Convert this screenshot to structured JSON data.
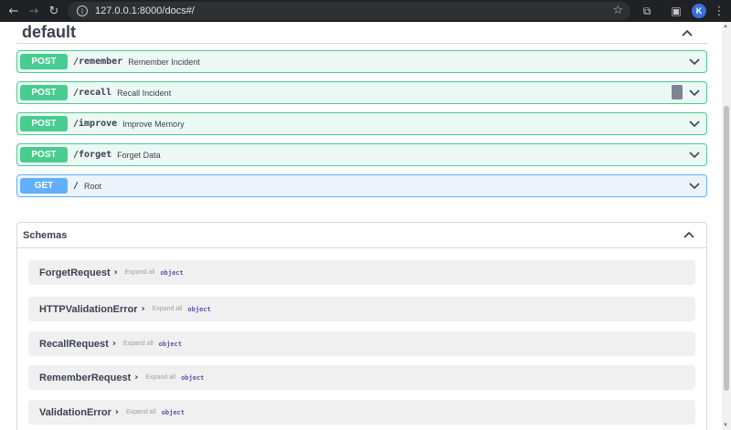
{
  "browser": {
    "url": "127.0.0.1:8000/docs#/",
    "profile_initial": "K"
  },
  "section": {
    "title": "default"
  },
  "operations": [
    {
      "method": "POST",
      "path": "/remember",
      "summary": "Remember Incident"
    },
    {
      "method": "POST",
      "path": "/recall",
      "summary": "Recall Incident"
    },
    {
      "method": "POST",
      "path": "/improve",
      "summary": "Improve Memory"
    },
    {
      "method": "POST",
      "path": "/forget",
      "summary": "Forget Data"
    },
    {
      "method": "GET",
      "path": "/",
      "summary": "Root"
    }
  ],
  "schemas": {
    "title": "Schemas",
    "expand_label": "Expand all",
    "type_label": "object",
    "models": [
      "ForgetRequest",
      "HTTPValidationError",
      "RecallRequest",
      "RememberRequest",
      "ValidationError"
    ]
  },
  "colors": {
    "post": "#49cc90",
    "get": "#61affe"
  }
}
